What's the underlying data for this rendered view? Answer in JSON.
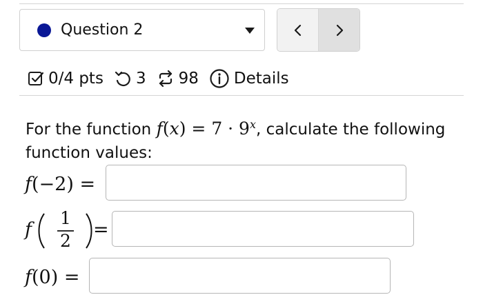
{
  "header": {
    "question_label": "Question 2",
    "status_color": "#0a1896",
    "prev_label": "<",
    "next_label": ">"
  },
  "status": {
    "score": "0/4 pts",
    "retries": "3",
    "versions": "98",
    "details_label": "Details",
    "icons": [
      "checkbox-icon",
      "retry-icon",
      "versions-icon",
      "info-icon"
    ]
  },
  "problem": {
    "prefix": "For the function ",
    "func": "f",
    "lparen": "(",
    "var": "x",
    "rparen_eq": ") = 7 · 9",
    "exponent": "x",
    "suffix": ", calculate the following function values:"
  },
  "answers": [
    {
      "func": "f",
      "arg": "(−2)",
      "eq": "=",
      "value": ""
    },
    {
      "func": "f",
      "numerator": "1",
      "denominator": "2",
      "eq": "=",
      "value": ""
    },
    {
      "func": "f",
      "arg": "(0)",
      "eq": "=",
      "value": ""
    }
  ]
}
